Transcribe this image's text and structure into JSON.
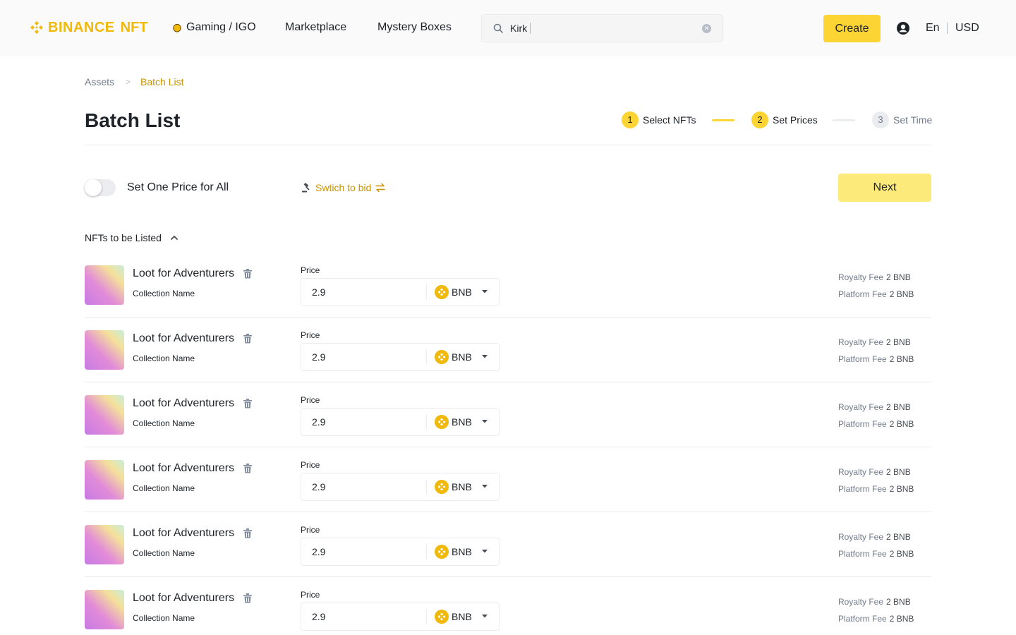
{
  "header": {
    "logo_text": "BINANCE",
    "logo_suffix": "NFT",
    "nav": [
      {
        "label": "Gaming / IGO"
      },
      {
        "label": "Marketplace"
      },
      {
        "label": "Mystery Boxes"
      }
    ],
    "search_value": "Kirk",
    "create_label": "Create",
    "language": "En",
    "currency": "USD"
  },
  "breadcrumb": {
    "parent": "Assets",
    "current": "Batch List"
  },
  "page_title": "Batch List",
  "stepper": [
    {
      "num": "1",
      "label": "Select NFTs",
      "state": "done"
    },
    {
      "num": "2",
      "label": "Set Prices",
      "state": "active"
    },
    {
      "num": "3",
      "label": "Set Time",
      "state": "inactive"
    }
  ],
  "controls": {
    "toggle_label": "Set One Price for All",
    "toggle_on": false,
    "switch_label": "Swtich to bid",
    "next_label": "Next"
  },
  "section_title": "NFTs to be Listed",
  "price_label": "Price",
  "royalty_label": "Royalty Fee",
  "platform_label": "Platform Fee",
  "nfts": [
    {
      "name": "Loot for Adventurers",
      "collection": "Collection Name",
      "price": "2.9",
      "token": "BNB",
      "royalty": "2 BNB",
      "platform": "2 BNB"
    },
    {
      "name": "Loot for Adventurers",
      "collection": "Collection Name",
      "price": "2.9",
      "token": "BNB",
      "royalty": "2 BNB",
      "platform": "2 BNB"
    },
    {
      "name": "Loot for Adventurers",
      "collection": "Collection Name",
      "price": "2.9",
      "token": "BNB",
      "royalty": "2 BNB",
      "platform": "2 BNB"
    },
    {
      "name": "Loot for Adventurers",
      "collection": "Collection Name",
      "price": "2.9",
      "token": "BNB",
      "royalty": "2 BNB",
      "platform": "2 BNB"
    },
    {
      "name": "Loot for Adventurers",
      "collection": "Collection Name",
      "price": "2.9",
      "token": "BNB",
      "royalty": "2 BNB",
      "platform": "2 BNB"
    },
    {
      "name": "Loot for Adventurers",
      "collection": "Collection Name",
      "price": "2.9",
      "token": "BNB",
      "royalty": "2 BNB",
      "platform": "2 BNB"
    }
  ],
  "colors": {
    "brand_yellow": "#FCD535",
    "accent_gold": "#C99400",
    "text_primary": "#1E2329",
    "text_secondary": "#707A8A"
  }
}
